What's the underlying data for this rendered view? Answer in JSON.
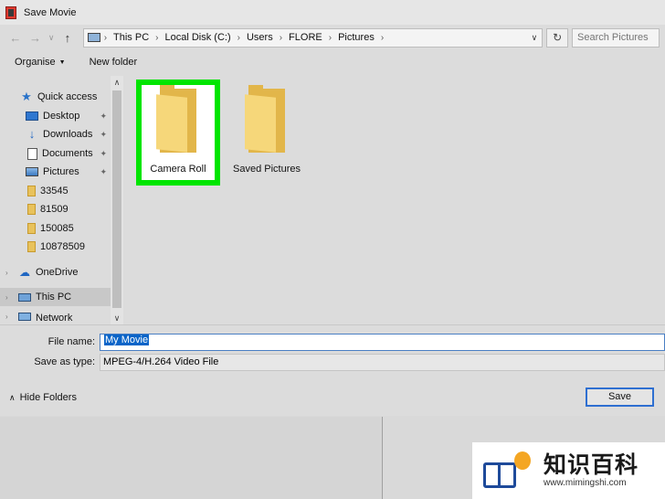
{
  "window": {
    "title": "Save Movie"
  },
  "address": {
    "breadcrumbs": [
      "This PC",
      "Local Disk (C:)",
      "Users",
      "FLORE",
      "Pictures"
    ],
    "search_placeholder": "Search Pictures"
  },
  "toolbar": {
    "organise": "Organise",
    "new_folder": "New folder"
  },
  "sidebar": {
    "items": [
      {
        "label": "Quick access",
        "icon": "star-icon"
      },
      {
        "label": "Desktop",
        "icon": "desktop-icon",
        "pinned": true
      },
      {
        "label": "Downloads",
        "icon": "download-arrow-icon",
        "pinned": true
      },
      {
        "label": "Documents",
        "icon": "documents-icon",
        "pinned": true
      },
      {
        "label": "Pictures",
        "icon": "pictures-icon",
        "pinned": true
      },
      {
        "label": "33545",
        "icon": "folder-icon"
      },
      {
        "label": "81509",
        "icon": "folder-icon"
      },
      {
        "label": "150085",
        "icon": "folder-icon"
      },
      {
        "label": "10878509",
        "icon": "folder-icon"
      },
      {
        "label": "OneDrive",
        "icon": "cloud-icon"
      },
      {
        "label": "This PC",
        "icon": "computer-icon",
        "selected": true
      },
      {
        "label": "Network",
        "icon": "network-icon"
      }
    ]
  },
  "files": [
    {
      "label": "Camera Roll",
      "highlighted": true
    },
    {
      "label": "Saved Pictures",
      "highlighted": false
    }
  ],
  "form": {
    "filename_label": "File name:",
    "filename_value": "My Movie",
    "type_label": "Save as type:",
    "type_value": "MPEG-4/H.264 Video File",
    "hide_folders": "Hide Folders",
    "save_label": "Save"
  },
  "colors": {
    "highlight": "#00e500",
    "selection": "#0a64c8",
    "accent": "#2e6fd1"
  },
  "watermark": {
    "title": "知识百科",
    "url": "www.mimingshi.com"
  }
}
